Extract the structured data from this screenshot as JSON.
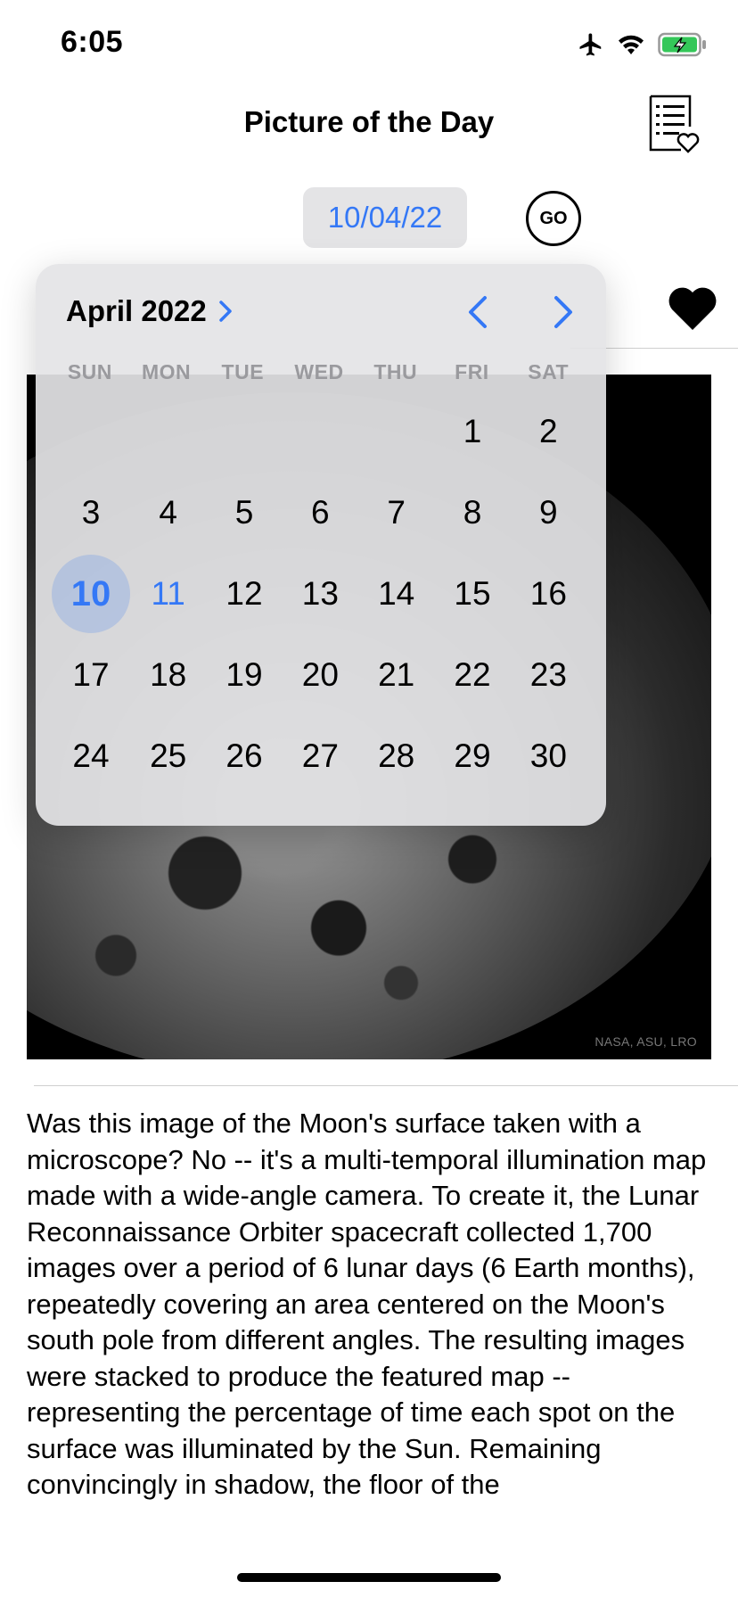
{
  "status_bar": {
    "time": "6:05"
  },
  "nav": {
    "title": "Picture of the Day",
    "favorites_icon": "list-heart-icon"
  },
  "date_picker": {
    "value": "10/04/22"
  },
  "go_button": {
    "label": "GO"
  },
  "favorite": {
    "icon": "heart-filled-icon"
  },
  "calendar": {
    "month_label": "April 2022",
    "weekdays": [
      "SUN",
      "MON",
      "TUE",
      "WED",
      "THU",
      "FRI",
      "SAT"
    ],
    "selected_day": "10",
    "today": "11",
    "days": [
      "",
      "",
      "",
      "",
      "",
      "1",
      "2",
      "3",
      "4",
      "5",
      "6",
      "7",
      "8",
      "9",
      "10",
      "11",
      "12",
      "13",
      "14",
      "15",
      "16",
      "17",
      "18",
      "19",
      "20",
      "21",
      "22",
      "23",
      "24",
      "25",
      "26",
      "27",
      "28",
      "29",
      "30"
    ],
    "accent_color": "#3478f6"
  },
  "image": {
    "credit": "NASA, ASU, LRO"
  },
  "explanation": "Was this image of the Moon's surface taken with a microscope? No -- it's a multi-temporal illumination map made with a wide-angle camera. To create it, the Lunar Reconnaissance Orbiter spacecraft collected 1,700 images over a period of 6 lunar days (6 Earth months), repeatedly covering an area centered on the Moon's south pole from different angles.  The resulting images were stacked to produce the featured map -- representing the percentage of time each spot on the surface was illuminated by the Sun. Remaining convincingly in shadow, the floor of the"
}
